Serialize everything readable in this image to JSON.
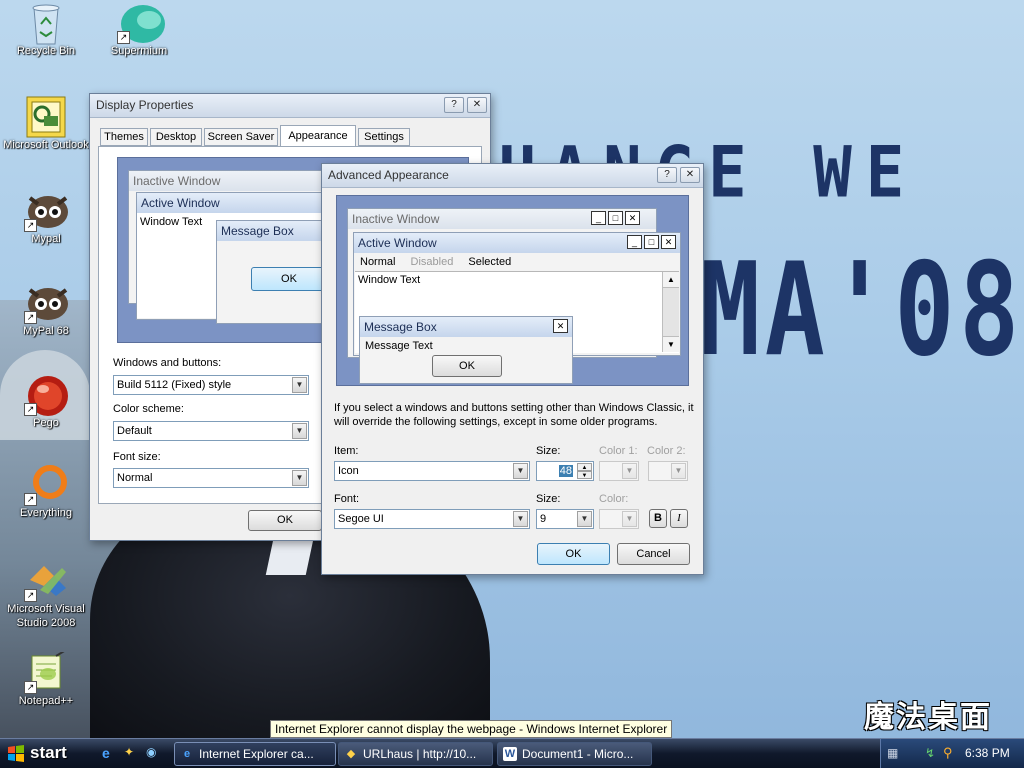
{
  "desktop": {
    "icons": [
      {
        "label": "Recycle Bin"
      },
      {
        "label": "Supermium"
      },
      {
        "label": "Microsoft Outlook"
      },
      {
        "label": "Mypal"
      },
      {
        "label": "MyPal 68"
      },
      {
        "label": "Pego"
      },
      {
        "label": "Everything"
      },
      {
        "label": "Microsoft Visual Studio 2008"
      },
      {
        "label": "Notepad++"
      }
    ],
    "wallpaper": {
      "line1": "HANGE WE NEED",
      "line2": "MA'08",
      "logo": "魔法桌面"
    }
  },
  "display_properties": {
    "title": "Display Properties",
    "help_button": "?",
    "close_button": "✕",
    "tabs": [
      "Themes",
      "Desktop",
      "Screen Saver",
      "Appearance",
      "Settings"
    ],
    "active_tab": "Appearance",
    "preview": {
      "inactive_title": "Inactive Window",
      "active_title": "Active Window",
      "window_text": "Window Text",
      "message_box_title": "Message Box",
      "ok": "OK"
    },
    "windows_and_buttons_label": "Windows and buttons:",
    "windows_and_buttons_value": "Build 5112 (Fixed) style",
    "color_scheme_label": "Color scheme:",
    "color_scheme_value": "Default",
    "font_size_label": "Font size:",
    "font_size_value": "Normal",
    "ok": "OK"
  },
  "advanced_appearance": {
    "title": "Advanced Appearance",
    "help_button": "?",
    "close_button": "✕",
    "preview": {
      "inactive_title": "Inactive Window",
      "active_title": "Active Window",
      "menu_normal": "Normal",
      "menu_disabled": "Disabled",
      "menu_selected": "Selected",
      "window_text": "Window Text",
      "message_box_title": "Message Box",
      "message_text": "Message Text",
      "ok": "OK"
    },
    "info_text": "If you select a windows and buttons setting other than Windows Classic, it will override the following settings, except in some older programs.",
    "item_label": "Item:",
    "item_value": "Icon",
    "item_size_label": "Size:",
    "item_size_value": "48",
    "color1_label": "Color 1:",
    "color2_label": "Color 2:",
    "font_label": "Font:",
    "font_value": "Segoe UI",
    "font_size_label": "Size:",
    "font_size_value": "9",
    "font_color_label": "Color:",
    "bold": "B",
    "italic": "I",
    "ok": "OK",
    "cancel": "Cancel"
  },
  "taskbar": {
    "start": "start",
    "tasks": [
      {
        "label": "Internet Explorer ca..."
      },
      {
        "label": "URLhaus | http://10..."
      },
      {
        "label": "Document1 - Micro..."
      }
    ],
    "clock": "6:38 PM"
  },
  "tooltip": "Internet Explorer cannot display the webpage - Windows Internet Explorer",
  "colors": {
    "accent": "#3c7fb1",
    "taskbar": "#10192b",
    "wallpaper_text": "#1d3466"
  }
}
